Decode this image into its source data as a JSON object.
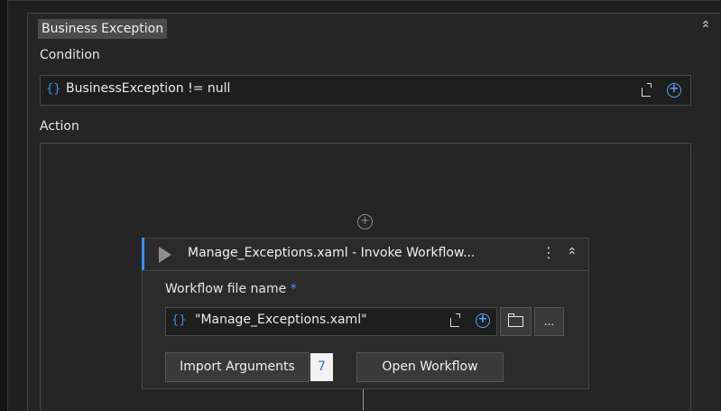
{
  "sequence": {
    "title": "Business Exception",
    "collapse_icon": "double-chevron-up-icon"
  },
  "condition": {
    "label": "Condition",
    "braces": "{}",
    "value": "BusinessException != null"
  },
  "action": {
    "label": "Action"
  },
  "invoke_workflow": {
    "title": "Manage_Exceptions.xaml - Invoke Workflow...",
    "field_label": "Workflow file name",
    "required_marker": "*",
    "braces": "{}",
    "field_value": "\"Manage_Exceptions.xaml\"",
    "more_label": "...",
    "import_label": "Import Arguments",
    "argument_count": "7",
    "open_label": "Open Workflow"
  },
  "colors": {
    "accent": "#3e8ef7",
    "background": "#252526",
    "field": "#1e1e1e"
  }
}
